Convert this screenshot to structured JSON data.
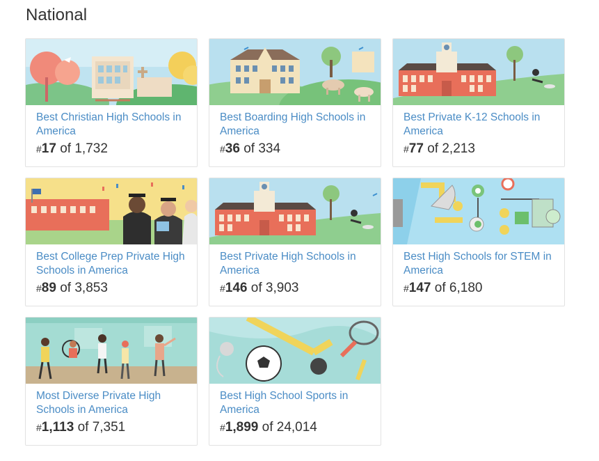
{
  "section": {
    "title": "National"
  },
  "cards": [
    {
      "title": "Best Christian High Schools in America",
      "hash": "#",
      "rank": "17",
      "of_text": "of 1,732",
      "image_icon": "church-school-illustration"
    },
    {
      "title": "Best Boarding High Schools in America",
      "hash": "#",
      "rank": "36",
      "of_text": "of 334",
      "image_icon": "boarding-campus-illustration"
    },
    {
      "title": "Best Private K-12 Schools in America",
      "hash": "#",
      "rank": "77",
      "of_text": "of 2,213",
      "image_icon": "private-campus-illustration"
    },
    {
      "title": "Best College Prep Private High Schools in America",
      "hash": "#",
      "rank": "89",
      "of_text": "of 3,853",
      "image_icon": "graduates-illustration"
    },
    {
      "title": "Best Private High Schools in America",
      "hash": "#",
      "rank": "146",
      "of_text": "of 3,903",
      "image_icon": "private-campus-illustration"
    },
    {
      "title": "Best High Schools for STEM in America",
      "hash": "#",
      "rank": "147",
      "of_text": "of 6,180",
      "image_icon": "stem-illustration"
    },
    {
      "title": "Most Diverse Private High Schools in America",
      "hash": "#",
      "rank": "1,113",
      "of_text": "of 7,351",
      "image_icon": "diverse-students-illustration"
    },
    {
      "title": "Best High School Sports in America",
      "hash": "#",
      "rank": "1,899",
      "of_text": "of 24,014",
      "image_icon": "sports-illustration"
    }
  ],
  "colors": {
    "link": "#4a8cc5",
    "text": "#333333",
    "border": "#e2e2e2"
  }
}
